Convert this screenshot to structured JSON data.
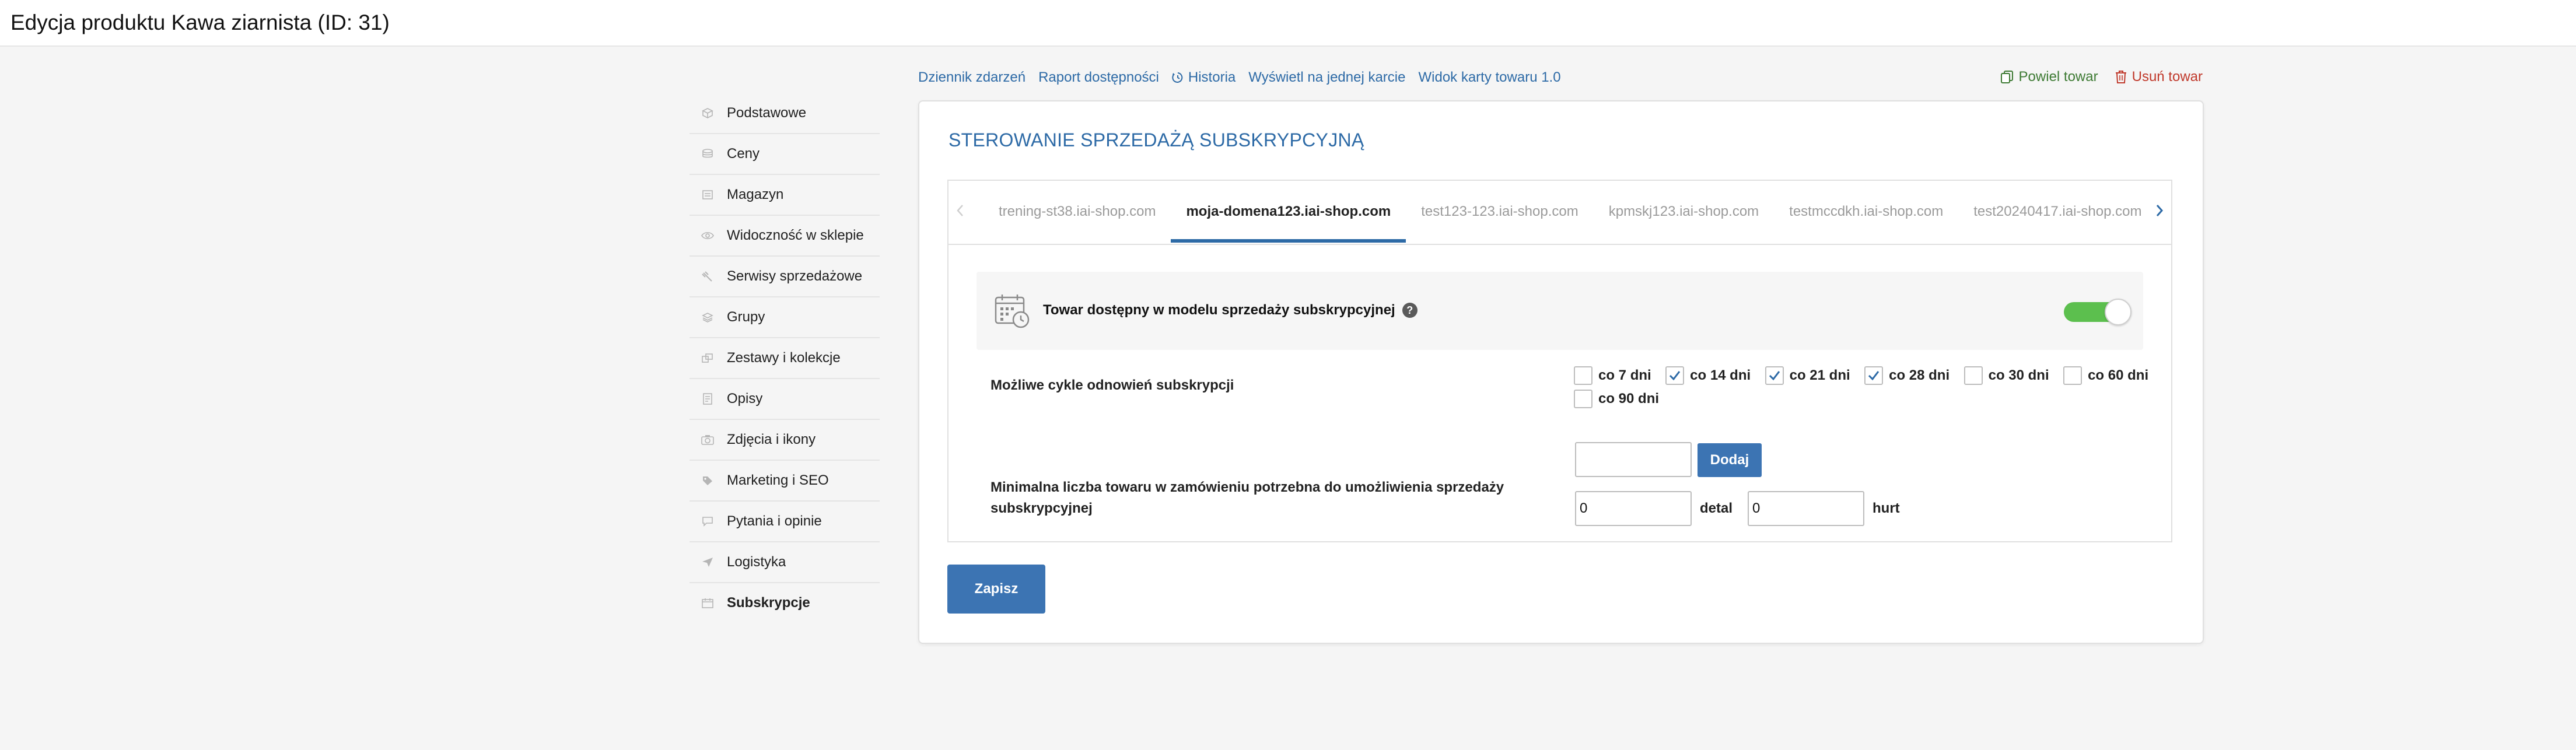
{
  "header": {
    "title": "Edycja produktu Kawa ziarnista (ID: 31)"
  },
  "sidebar": {
    "items": [
      {
        "label": "Podstawowe",
        "icon": "box-icon"
      },
      {
        "label": "Ceny",
        "icon": "coins-icon"
      },
      {
        "label": "Magazyn",
        "icon": "warehouse-icon"
      },
      {
        "label": "Widoczność w sklepie",
        "icon": "eye-icon"
      },
      {
        "label": "Serwisy sprzedażowe",
        "icon": "gavel-icon"
      },
      {
        "label": "Grupy",
        "icon": "layers-icon"
      },
      {
        "label": "Zestawy i kolekcje",
        "icon": "sets-icon"
      },
      {
        "label": "Opisy",
        "icon": "document-icon"
      },
      {
        "label": "Zdjęcia i ikony",
        "icon": "camera-icon"
      },
      {
        "label": "Marketing i SEO",
        "icon": "tag-icon"
      },
      {
        "label": "Pytania i opinie",
        "icon": "chat-icon"
      },
      {
        "label": "Logistyka",
        "icon": "send-icon"
      },
      {
        "label": "Subskrypcje",
        "icon": "calendar-icon",
        "active": true
      }
    ]
  },
  "toplinks": {
    "event_log": "Dziennik zdarzeń",
    "availability_report": "Raport dostępności",
    "history": "Historia",
    "single_card": "Wyświetl na jednej karcie",
    "card_view": "Widok karty towaru 1.0"
  },
  "actions": {
    "clone": "Powiel towar",
    "delete": "Usuń towar"
  },
  "section": {
    "title": "STEROWANIE SPRZEDAŻĄ SUBSKRYPCYJNĄ"
  },
  "tabs": [
    "trening-st38.iai-shop.com",
    "moja-domena123.iai-shop.com",
    "test123-123.iai-shop.com",
    "kpmskj123.iai-shop.com",
    "testmccdkh.iai-shop.com",
    "test20240417.iai-shop.com"
  ],
  "active_tab": 1,
  "toggle": {
    "label": "Towar dostępny w modelu sprzedaży subskrypcyjnej",
    "on": true
  },
  "cycles": {
    "label": "Możliwe cykle odnowień subskrypcji",
    "options": [
      {
        "label": "co 7 dni",
        "checked": false
      },
      {
        "label": "co 14 dni",
        "checked": true
      },
      {
        "label": "co 21 dni",
        "checked": true
      },
      {
        "label": "co 28 dni",
        "checked": true
      },
      {
        "label": "co 30 dni",
        "checked": false
      },
      {
        "label": "co 60 dni",
        "checked": false
      },
      {
        "label": "co 90 dni",
        "checked": false
      }
    ],
    "add_label": "Dodaj",
    "add_value": ""
  },
  "min_qty": {
    "label": "Minimalna liczba towaru w zamówieniu potrzebna do umożliwienia sprzedaży subskrypcyjnej",
    "retail_value": "0",
    "retail_unit": "detal",
    "wholesale_value": "0",
    "wholesale_unit": "hurt"
  },
  "save_label": "Zapisz",
  "colors": {
    "link": "#2d6aa6",
    "primary_button": "#3c74b3",
    "toggle_on": "#5cbf4e",
    "clone": "#3d7a33",
    "delete": "#c0392b"
  }
}
